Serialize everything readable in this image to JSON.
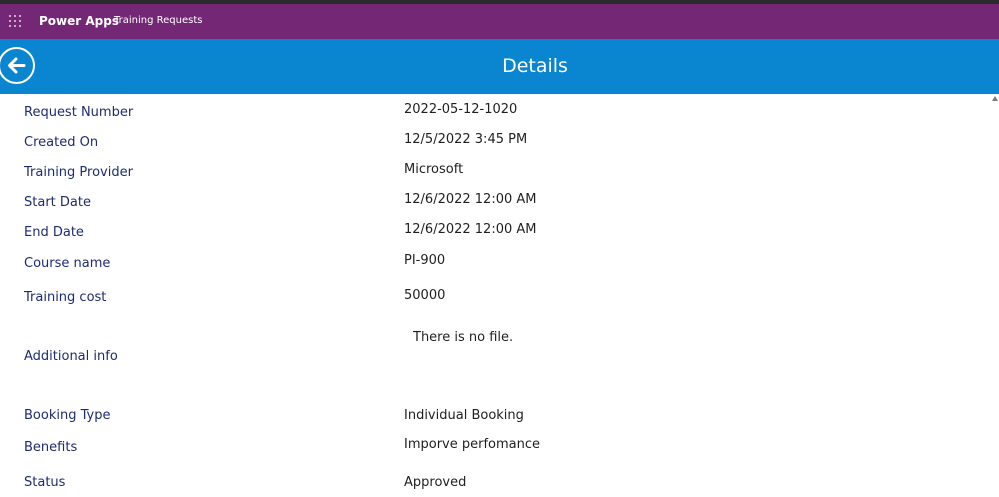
{
  "appbar": {
    "app_name": "Power Apps",
    "app_title": "Training Requests",
    "waffle_icon": "waffle-icon"
  },
  "header": {
    "title": "Details",
    "back_icon": "arrow-left-icon"
  },
  "fields": [
    {
      "label": "Request Number",
      "value": "2022-05-12-1020"
    },
    {
      "label": "Created On",
      "value": "12/5/2022 3:45 PM"
    },
    {
      "label": "Training Provider",
      "value": "Microsoft"
    },
    {
      "label": "Start Date",
      "value": "12/6/2022 12:00 AM"
    },
    {
      "label": "End Date",
      "value": "12/6/2022 12:00 AM"
    },
    {
      "label": "Course name",
      "value": "PI-900"
    },
    {
      "label": "Training cost",
      "value": "50000"
    },
    {
      "label": "Additional info",
      "value": "There is no file."
    },
    {
      "label": "Booking Type",
      "value": "Individual Booking"
    },
    {
      "label": "Benefits",
      "value": "Imporve perfomance"
    },
    {
      "label": "Status",
      "value": "Approved"
    }
  ],
  "colors": {
    "appbar": "#742774",
    "header": "#0a86d0",
    "label": "#1e2b6f"
  }
}
